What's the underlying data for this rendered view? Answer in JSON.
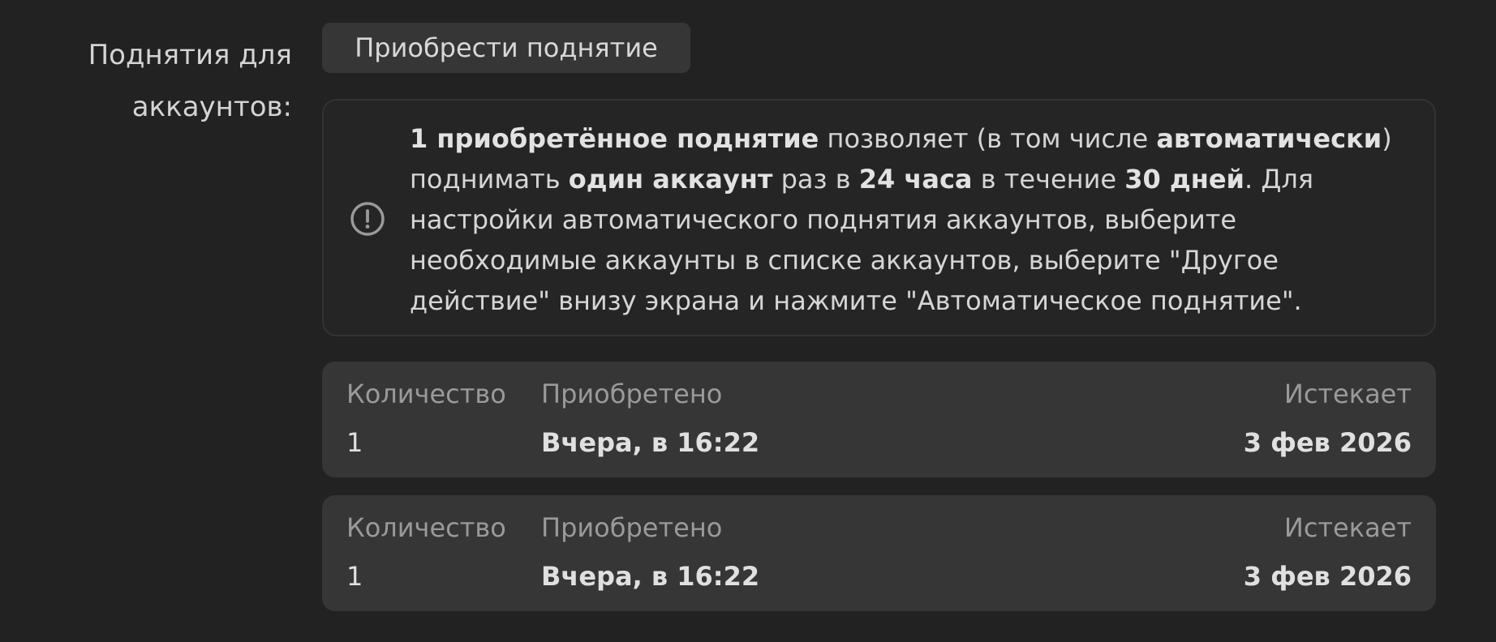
{
  "label": {
    "line1": "Поднятия для",
    "line2": "аккаунтов:"
  },
  "buy_button": "Приобрести поднятие",
  "info": {
    "icon": "exclamation-circle-icon",
    "t1": "1 приобретённое поднятие",
    "t2": " позволяет (в том числе ",
    "t3": "автоматически",
    "t4": ") поднимать ",
    "t5": "один аккаунт",
    "t6": " раз в ",
    "t7": "24 часа",
    "t8": " в течение ",
    "t9": "30 дней",
    "t10": ". Для настройки автоматического поднятия аккаунтов, выберите необходимые аккаунты в списке аккаунтов, выберите \"Другое действие\" внизу экрана и нажмите \"Автоматическое поднятие\"."
  },
  "purchases": [
    {
      "qty_label": "Количество",
      "qty": "1",
      "bought_label": "Приобретено",
      "bought": "Вчера, в 16:22",
      "expires_label": "Истекает",
      "expires": "3 фев 2026"
    },
    {
      "qty_label": "Количество",
      "qty": "1",
      "bought_label": "Приобретено",
      "bought": "Вчера, в 16:22",
      "expires_label": "Истекает",
      "expires": "3 фев 2026"
    }
  ],
  "colors": {
    "background": "#222222",
    "card": "#363636",
    "muted_text": "#9a9a9a"
  }
}
